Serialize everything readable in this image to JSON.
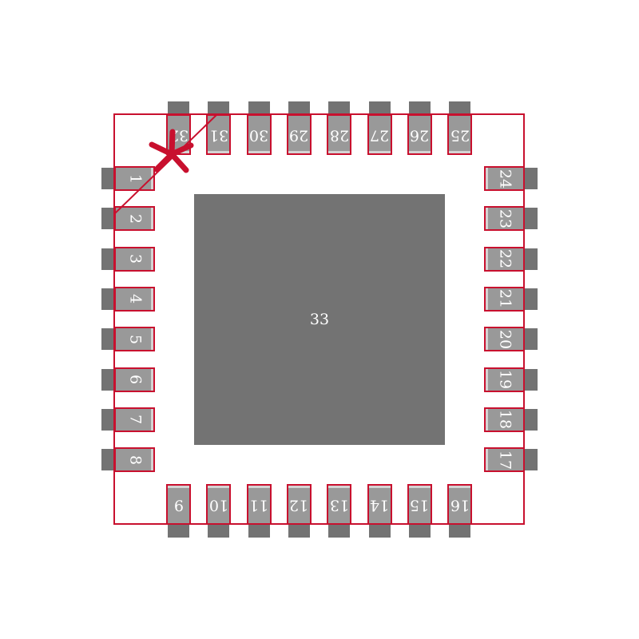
{
  "footprint": {
    "package": "QFN-32 with exposed pad",
    "colors": {
      "outline": "#c8102e",
      "pad_fill": "#999999",
      "pad_dark": "#737373",
      "pad_highlight": "#d4d4d4",
      "label": "#ffffff"
    },
    "center_pad": {
      "label": "33"
    },
    "pins": {
      "left": [
        "1",
        "2",
        "3",
        "4",
        "5",
        "6",
        "7",
        "8"
      ],
      "bottom": [
        "9",
        "10",
        "11",
        "12",
        "13",
        "14",
        "15",
        "16"
      ],
      "right": [
        "17",
        "18",
        "19",
        "20",
        "21",
        "22",
        "23",
        "24"
      ],
      "top": [
        "25",
        "26",
        "27",
        "28",
        "29",
        "30",
        "31",
        "32"
      ]
    },
    "pin1_marker": "asterisk-with-diagonal-line"
  }
}
